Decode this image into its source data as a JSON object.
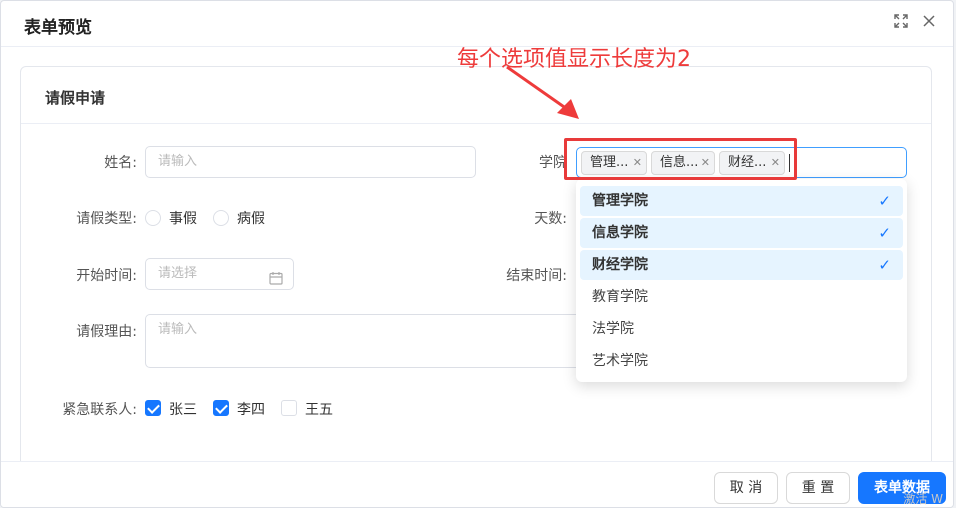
{
  "dialog": {
    "title": "表单预览"
  },
  "annotation": {
    "text": "每个选项值显示长度为2"
  },
  "card": {
    "title": "请假申请"
  },
  "form": {
    "name": {
      "label": "姓名:",
      "placeholder": "请输入"
    },
    "college": {
      "label": "学院",
      "tags": [
        "管理...",
        "信息...",
        "财经..."
      ]
    },
    "leave_type": {
      "label": "请假类型:",
      "options": [
        "事假",
        "病假"
      ]
    },
    "days": {
      "label": "天数:"
    },
    "start_time": {
      "label": "开始时间:",
      "placeholder": "请选择"
    },
    "end_time": {
      "label": "结束时间:"
    },
    "reason": {
      "label": "请假理由:",
      "placeholder": "请输入"
    },
    "contacts": {
      "label": "紧急联系人:",
      "options": [
        {
          "label": "张三",
          "checked": true
        },
        {
          "label": "李四",
          "checked": true
        },
        {
          "label": "王五",
          "checked": false
        }
      ]
    }
  },
  "dropdown": {
    "items": [
      {
        "label": "管理学院",
        "selected": true
      },
      {
        "label": "信息学院",
        "selected": true
      },
      {
        "label": "财经学院",
        "selected": true
      },
      {
        "label": "教育学院",
        "selected": false
      },
      {
        "label": "法学院",
        "selected": false
      },
      {
        "label": "艺术学院",
        "selected": false
      }
    ],
    "check_glyph": "✓"
  },
  "footer": {
    "cancel_label": "取 消",
    "reset_label": "重 置",
    "submit_label": "表单数据"
  },
  "watermark": "激活 W",
  "colors": {
    "primary": "#1677ff",
    "annotation": "#ee3b3b",
    "selected_bg": "#e6f4ff"
  }
}
